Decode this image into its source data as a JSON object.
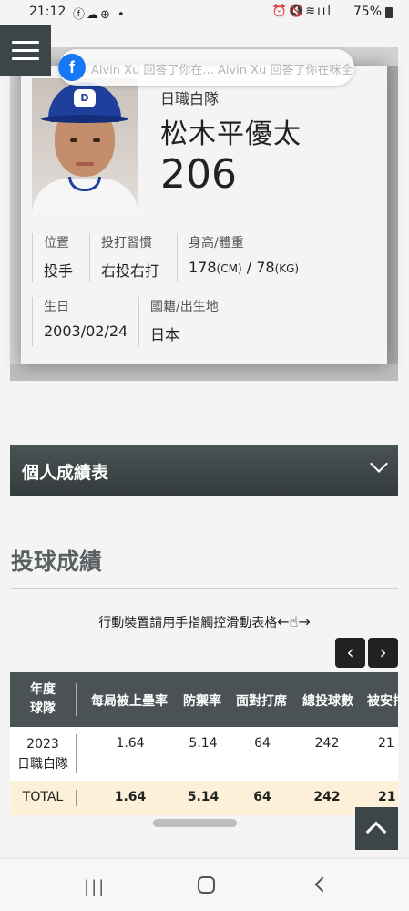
{
  "status_bar": {
    "time": "21:12",
    "left_icons": "facebook cloud game •",
    "battery": "75%",
    "right_icons": "alarm mute wifi signal"
  },
  "notification": {
    "icon": "facebook-icon",
    "text": "Alvin Xu 回答了你在...   Alvin Xu 回答了你在咪全..."
  },
  "player": {
    "team": "日職白隊",
    "name": "松木平優太",
    "number": "206",
    "position_label": "位置",
    "position_value": "投手",
    "habit_label": "投打習慣",
    "habit_value": "右投右打",
    "body_label": "身高/體重",
    "height": "178",
    "height_unit": "(CM)",
    "weight": "78",
    "weight_unit": "(KG)",
    "birth_label": "生日",
    "birth_value": "2003/02/24",
    "nation_label": "國籍/出生地",
    "nation_value": "日本"
  },
  "accordion": {
    "title": "個人成績表"
  },
  "section": {
    "title": "投球成績",
    "hint": "行動裝置請用手指觸控滑動表格",
    "hint_arrows": "←☝→",
    "prev": "‹",
    "next": "›"
  },
  "table": {
    "header_year": "年度",
    "header_team": "球隊",
    "columns": [
      "每局被上壘率",
      "防禦率",
      "面對打席",
      "總投球數",
      "被安打"
    ],
    "row": {
      "year": "2023",
      "team": "日職白隊",
      "values": [
        "1.64",
        "5.14",
        "64",
        "242",
        "21"
      ]
    },
    "total": {
      "label": "TOTAL",
      "values": [
        "1.64",
        "5.14",
        "64",
        "242",
        "21"
      ]
    }
  }
}
